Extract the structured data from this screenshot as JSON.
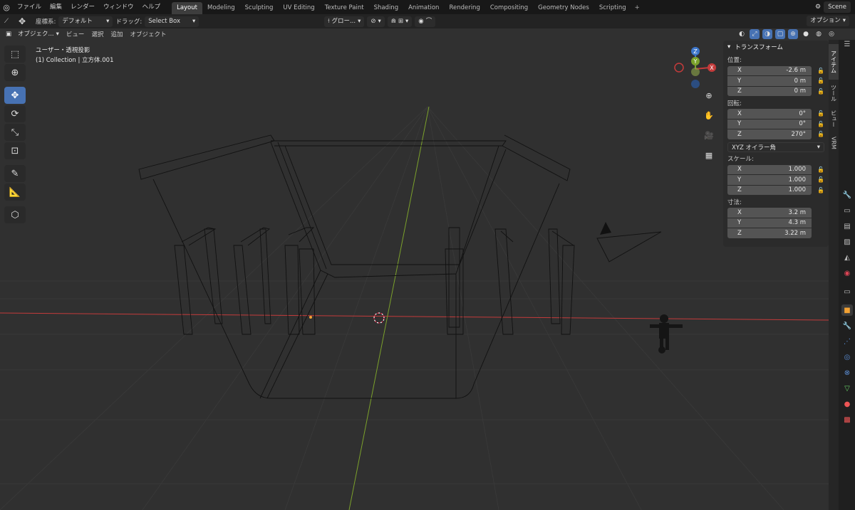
{
  "topbar": {
    "menus": [
      "ファイル",
      "編集",
      "レンダー",
      "ウィンドウ",
      "ヘルプ"
    ],
    "workspaces": [
      "Layout",
      "Modeling",
      "Sculpting",
      "UV Editing",
      "Texture Paint",
      "Shading",
      "Animation",
      "Rendering",
      "Compositing",
      "Geometry Nodes",
      "Scripting"
    ],
    "active_workspace": "Layout",
    "scene_name": "Scene"
  },
  "header": {
    "coord_label": "座標系:",
    "coord_value": "デフォルト",
    "drag_label": "ドラッグ:",
    "drag_value": "Select Box",
    "transform_orientation": "グロー...",
    "options": "オプション"
  },
  "header2": {
    "mode": "オブジェク...",
    "menus": [
      "ビュー",
      "選択",
      "追加",
      "オブジェクト"
    ]
  },
  "viewport": {
    "view_name": "ユーザー・透視投影",
    "collection_info": "(1) Collection | 立方体.001",
    "gizmo_axes": [
      "X",
      "Y",
      "Z"
    ],
    "colors": {
      "x_axis": "#c43b3b",
      "y_axis": "#7ba12b",
      "z_axis": "#3c75c9",
      "background": "#303030",
      "grid": "#3a3a3a"
    }
  },
  "npanel": {
    "title": "トランスフォーム",
    "location_label": "位置:",
    "location": [
      {
        "axis": "X",
        "value": "-2.6 m"
      },
      {
        "axis": "Y",
        "value": "0 m"
      },
      {
        "axis": "Z",
        "value": "0 m"
      }
    ],
    "rotation_label": "回転:",
    "rotation": [
      {
        "axis": "X",
        "value": "0°"
      },
      {
        "axis": "Y",
        "value": "0°"
      },
      {
        "axis": "Z",
        "value": "270°"
      }
    ],
    "rotation_mode": "XYZ オイラー角",
    "scale_label": "スケール:",
    "scale": [
      {
        "axis": "X",
        "value": "1.000"
      },
      {
        "axis": "Y",
        "value": "1.000"
      },
      {
        "axis": "Z",
        "value": "1.000"
      }
    ],
    "dimensions_label": "寸法:",
    "dimensions": [
      {
        "axis": "X",
        "value": "3.2 m"
      },
      {
        "axis": "Y",
        "value": "4.3 m"
      },
      {
        "axis": "Z",
        "value": "3.22 m"
      }
    ]
  },
  "side_tabs": [
    "アイテム",
    "ツール",
    "ビュー",
    "VRM"
  ],
  "property_icons": [
    "tool-icon",
    "render-icon",
    "output-icon",
    "view-layer-icon",
    "scene-icon",
    "world-icon",
    "collection-icon",
    "object-icon",
    "modifier-icon",
    "particles-icon",
    "physics-icon",
    "constraints-icon",
    "data-icon",
    "material-icon",
    "texture-icon"
  ]
}
